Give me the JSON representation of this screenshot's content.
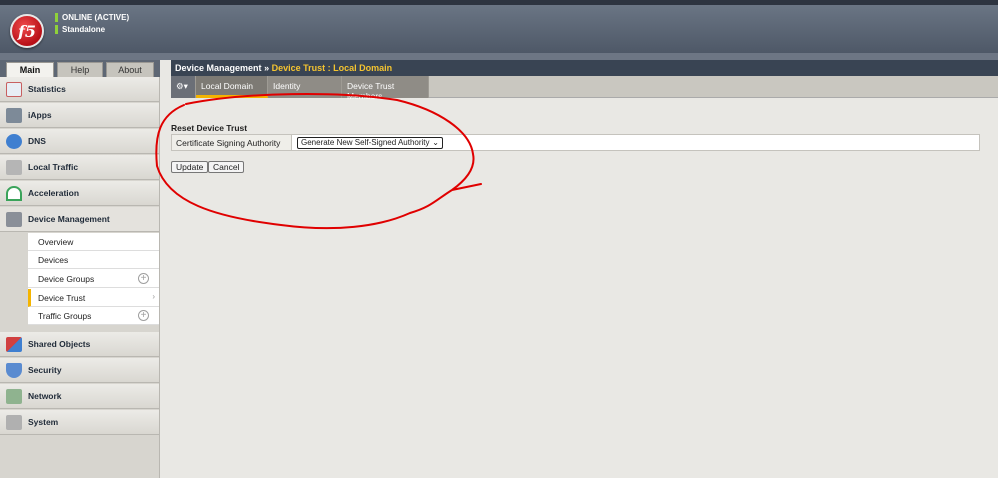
{
  "header": {
    "logo_text": "f5",
    "status_line_1": "ONLINE (ACTIVE)",
    "status_line_2": "Standalone"
  },
  "sidebar": {
    "tabs": [
      "Main",
      "Help",
      "About"
    ],
    "items": [
      {
        "label": "Statistics",
        "icon": "statistics-icon",
        "color": "#c86060"
      },
      {
        "label": "iApps",
        "icon": "iapps-icon",
        "color": "#7d8a98"
      },
      {
        "label": "DNS",
        "icon": "dns-icon",
        "color": "#3f7fd0"
      },
      {
        "label": "Local Traffic",
        "icon": "local-traffic-icon",
        "color": "#9a9a9a"
      },
      {
        "label": "Acceleration",
        "icon": "acceleration-icon",
        "color": "#3aa35a"
      },
      {
        "label": "Device Management",
        "icon": "device-management-icon",
        "color": "#8a8f98"
      },
      {
        "label": "Shared Objects",
        "icon": "shared-objects-icon",
        "color": "#d04040"
      },
      {
        "label": "Security",
        "icon": "security-icon",
        "color": "#5a8bd0"
      },
      {
        "label": "Network",
        "icon": "network-icon",
        "color": "#6a9a6a"
      },
      {
        "label": "System",
        "icon": "system-icon",
        "color": "#9a9a9a"
      }
    ],
    "submenu": [
      {
        "label": "Overview"
      },
      {
        "label": "Devices"
      },
      {
        "label": "Device Groups"
      },
      {
        "label": "Device Trust"
      },
      {
        "label": "Traffic Groups"
      }
    ]
  },
  "main": {
    "breadcrumb_prefix": "Device Management",
    "breadcrumb_sep": "»",
    "breadcrumb_current": "Device Trust : Local Domain",
    "tabs": [
      "Local Domain",
      "Identity",
      "Device Trust Members"
    ],
    "section_title": "Reset Device Trust",
    "field_label": "Certificate Signing Authority",
    "field_value": "Generate New Self-Signed Authority",
    "buttons": {
      "update": "Update",
      "cancel": "Cancel"
    }
  },
  "colors": {
    "accent": "#f4b400",
    "annotation": "#e00000"
  }
}
